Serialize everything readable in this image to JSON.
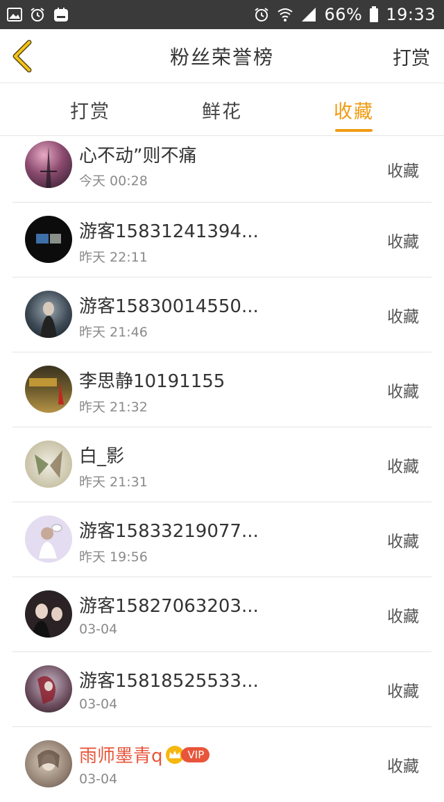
{
  "status_bar": {
    "battery": "66%",
    "time": "19:33",
    "left_icons": [
      "image-icon",
      "alarm-icon",
      "app-icon"
    ],
    "right_icons": [
      "alarm-icon",
      "wifi-icon",
      "signal-icon",
      "battery-icon"
    ]
  },
  "header": {
    "title": "粉丝荣誉榜",
    "action": "打赏",
    "back_icon": "chevron-left-icon"
  },
  "tabs": [
    {
      "label": "打赏",
      "active": false
    },
    {
      "label": "鲜花",
      "active": false
    },
    {
      "label": "收藏",
      "active": true
    }
  ],
  "colors": {
    "accent": "#f19b12",
    "vip_name": "#e8553a",
    "status_bar": "#3a3a3a"
  },
  "rows": [
    {
      "name": "心不动”则不痛",
      "time": "今天 00:28",
      "action": "收藏",
      "avatar": "#7a4d66"
    },
    {
      "name": "游客15831241394...",
      "time": "昨天 22:11",
      "action": "收藏",
      "avatar": "#111111"
    },
    {
      "name": "游客15830014550...",
      "time": "昨天 21:46",
      "action": "收藏",
      "avatar": "#3d4a55"
    },
    {
      "name": "李思静10191155",
      "time": "昨天 21:32",
      "action": "收藏",
      "avatar": "#6b5a2c"
    },
    {
      "name": "白_影",
      "time": "昨天 21:31",
      "action": "收藏",
      "avatar": "#c9c3a8"
    },
    {
      "name": "游客15833219077...",
      "time": "昨天 19:56",
      "action": "收藏",
      "avatar": "#d9cfe8"
    },
    {
      "name": "游客15827063203...",
      "time": "03-04",
      "action": "收藏",
      "avatar": "#2a2224"
    },
    {
      "name": "游客15818525533...",
      "time": "03-04",
      "action": "收藏",
      "avatar": "#6a4c5c"
    },
    {
      "name": "雨师墨青q",
      "time": "03-04",
      "action": "收藏",
      "avatar": "#8e7c6e",
      "vip": "VIP"
    }
  ]
}
